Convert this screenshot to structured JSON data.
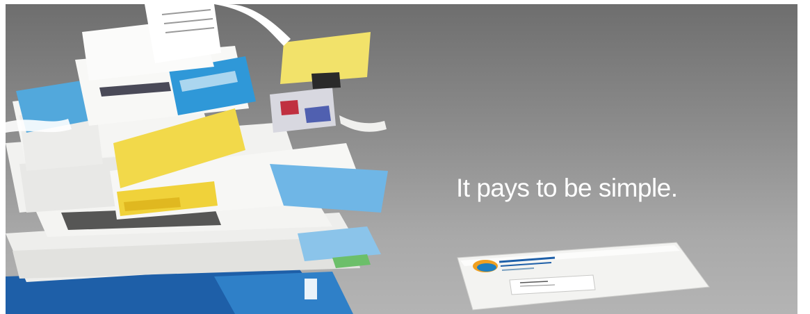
{
  "banner": {
    "tagline": "It pays to be simple.",
    "background_colors": [
      "#6e6e6e",
      "#b4b4b4"
    ]
  },
  "illustration": {
    "paper_pile": "cluttered stack of mail and bills",
    "envelope": "single window envelope with logo"
  },
  "colors": {
    "paper_white": "#f2f2f0",
    "accent_blue": "#3a9fd8",
    "accent_yellow": "#f2d94a",
    "logo_orange": "#f0a020"
  }
}
